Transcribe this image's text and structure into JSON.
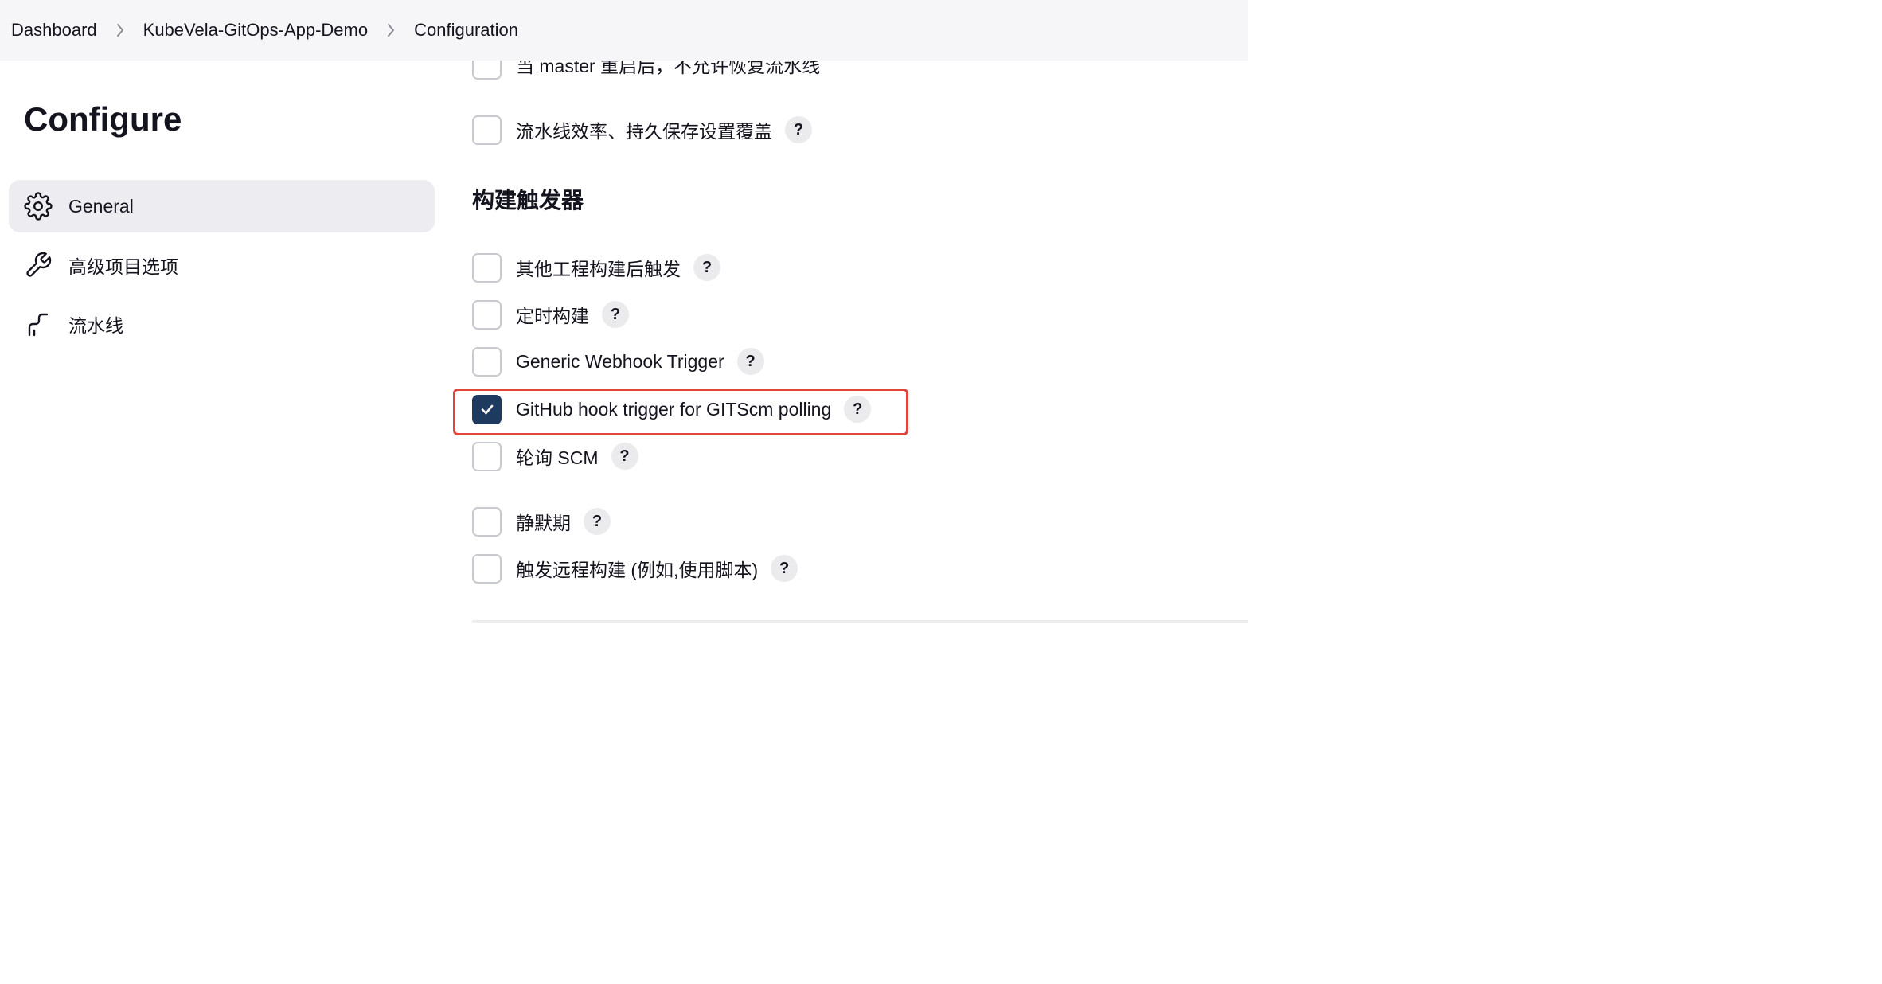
{
  "breadcrumb": {
    "items": [
      "Dashboard",
      "KubeVela-GitOps-App-Demo",
      "Configuration"
    ]
  },
  "sidebar": {
    "title": "Configure",
    "items": [
      {
        "label": "General",
        "icon": "gear-icon",
        "active": true
      },
      {
        "label": "高级项目选项",
        "icon": "wrench-icon",
        "active": false
      },
      {
        "label": "流水线",
        "icon": "pipeline-icon",
        "active": false
      }
    ]
  },
  "general_options": [
    {
      "label": "当 master 重启后，不允许恢复流水线",
      "checked": false,
      "help": false
    },
    {
      "label": "流水线效率、持久保存设置覆盖",
      "checked": false,
      "help": true
    }
  ],
  "triggers": {
    "heading": "构建触发器",
    "items": [
      {
        "label": "其他工程构建后触发",
        "checked": false
      },
      {
        "label": "定时构建",
        "checked": false
      },
      {
        "label": "Generic Webhook Trigger",
        "checked": false
      },
      {
        "label": "GitHub hook trigger for GITScm polling",
        "checked": true,
        "highlighted": true
      },
      {
        "label": "轮询 SCM",
        "checked": false
      },
      {
        "label": "静默期",
        "checked": false
      },
      {
        "label": "触发远程构建 (例如,使用脚本)",
        "checked": false
      }
    ]
  },
  "help_glyph": "?",
  "colors": {
    "accent": "#1e3a5f",
    "highlight": "#e0443a",
    "topbar": "#f6f6f8",
    "active_nav": "#ececf1"
  }
}
